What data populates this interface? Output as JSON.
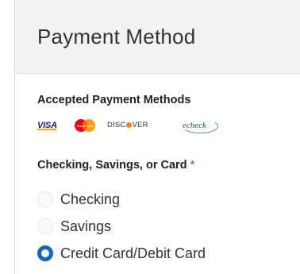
{
  "header": {
    "title": "Payment Method"
  },
  "accepted": {
    "label": "Accepted Payment Methods",
    "logos": [
      {
        "name": "visa",
        "text": "VISA"
      },
      {
        "name": "mastercard",
        "text": "MasterCard"
      },
      {
        "name": "discover",
        "text_before": "DISC",
        "text_after": "VER"
      },
      {
        "name": "echeck",
        "text": "echeck"
      }
    ]
  },
  "payment_type": {
    "label": "Checking, Savings, or Card",
    "required_mark": "*",
    "options": [
      {
        "label": "Checking",
        "selected": false
      },
      {
        "label": "Savings",
        "selected": false
      },
      {
        "label": "Credit Card/Debit Card",
        "selected": true
      }
    ]
  },
  "colors": {
    "accent": "#1565c0",
    "required": "#c0392b",
    "header_bg": "#f3f3f3"
  }
}
